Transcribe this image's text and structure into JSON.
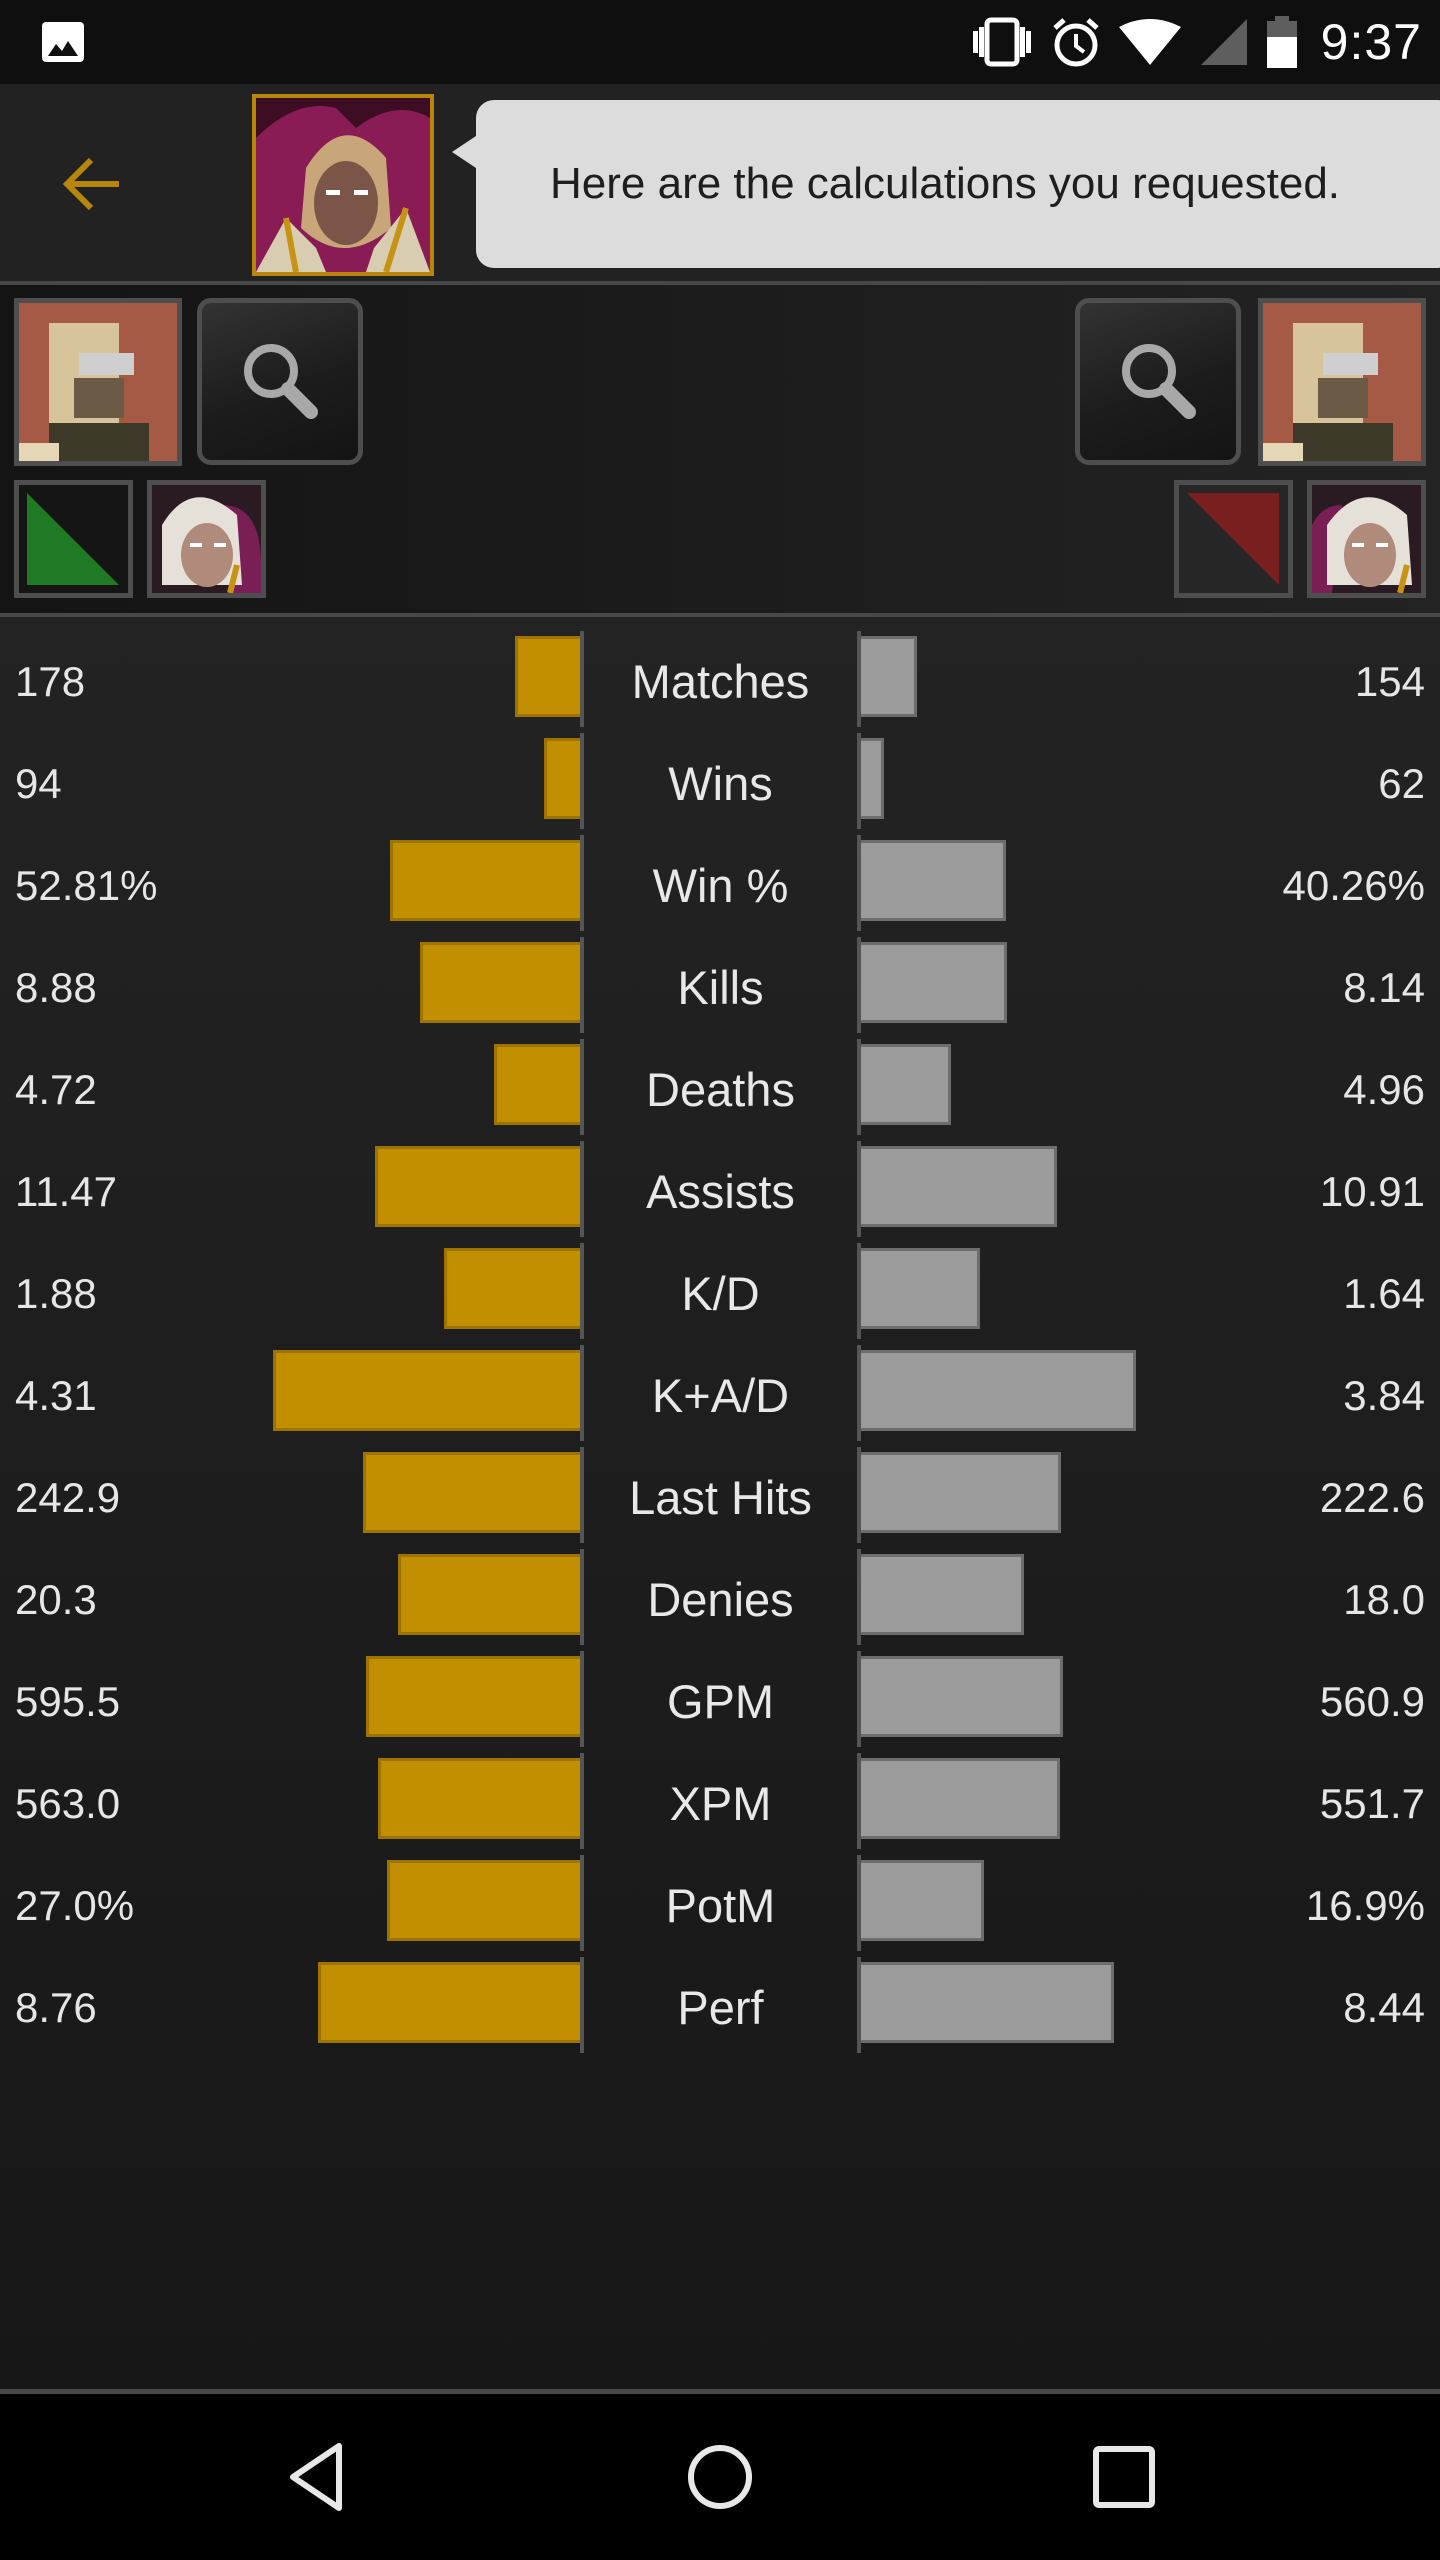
{
  "status_bar": {
    "time": "9:37",
    "icons": [
      "gallery-notification-icon",
      "vibrate-icon",
      "alarm-icon",
      "wifi-icon",
      "cellular-signal-icon",
      "battery-icon"
    ]
  },
  "toolbar": {
    "back_icon": "arrow-left-icon",
    "hero_portrait": "Invoker portrait",
    "message": "Here are the calculations you requested.",
    "accent_color": "#b8860b"
  },
  "players": {
    "left": {
      "avatar": "player-avatar (pixelated)",
      "search_icon": "magnifier-icon",
      "team": "radiant",
      "team_color": "#1f7a23",
      "hero": "Invoker"
    },
    "right": {
      "avatar": "player-avatar (pixelated)",
      "search_icon": "magnifier-icon",
      "team": "dire",
      "team_color": "#7a1f1f",
      "hero": "Invoker"
    }
  },
  "colors": {
    "left_bar": "#c28f00",
    "right_bar": "#9b9b9b"
  },
  "chart_data": {
    "type": "bar",
    "orientation": "horizontal-diverging",
    "title": "",
    "categories": [
      "Matches",
      "Wins",
      "Win %",
      "Kills",
      "Deaths",
      "Assists",
      "K/D",
      "K+A/D",
      "Last Hits",
      "Denies",
      "GPM",
      "XPM",
      "PotM",
      "Perf"
    ],
    "series": [
      {
        "name": "left player",
        "color": "#c28f00",
        "labels": [
          "178",
          "94",
          "52.81%",
          "8.88",
          "4.72",
          "11.47",
          "1.88",
          "4.31",
          "242.9",
          "20.3",
          "595.5",
          "563.0",
          "27.0%",
          "8.76"
        ],
        "values": [
          178,
          94,
          52.81,
          8.88,
          4.72,
          11.47,
          1.88,
          4.31,
          242.9,
          20.3,
          595.5,
          563.0,
          27.0,
          8.76
        ],
        "bar_fill": [
          0.116,
          0.064,
          0.339,
          0.286,
          0.154,
          0.366,
          0.243,
          0.548,
          0.388,
          0.325,
          0.382,
          0.361,
          0.345,
          0.468
        ]
      },
      {
        "name": "right player",
        "color": "#9b9b9b",
        "labels": [
          "154",
          "62",
          "40.26%",
          "8.14",
          "4.96",
          "10.91",
          "1.64",
          "3.84",
          "222.6",
          "18.0",
          "560.9",
          "551.7",
          "16.9%",
          "8.44"
        ],
        "values": [
          154,
          62,
          40.26,
          8.14,
          4.96,
          10.91,
          1.64,
          3.84,
          222.6,
          18.0,
          560.9,
          551.7,
          16.9,
          8.44
        ],
        "bar_fill": [
          0.1,
          0.041,
          0.259,
          0.261,
          0.161,
          0.35,
          0.213,
          0.491,
          0.357,
          0.291,
          0.361,
          0.355,
          0.22,
          0.452
        ]
      }
    ],
    "xlabel": "",
    "ylabel": "",
    "grid": false,
    "legend": "none"
  },
  "navbar": {
    "back": "nav-back-icon",
    "home": "nav-home-icon",
    "recents": "nav-recents-icon"
  }
}
